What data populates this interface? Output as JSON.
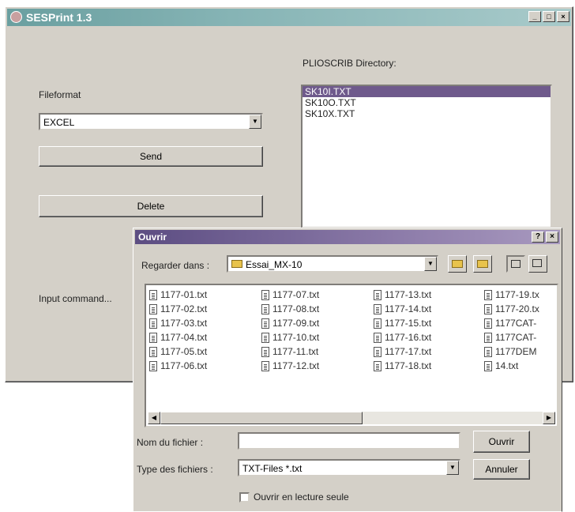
{
  "main_window": {
    "title": "SESPrint 1.3",
    "fileformat_label": "Fileformat",
    "fileformat_value": "EXCEL",
    "send_label": "Send",
    "delete_label": "Delete",
    "input_command_label": "Input command...",
    "directory_label": "PLIOSCRIB Directory:",
    "directory_files": [
      "SK10I.TXT",
      "SK10O.TXT",
      "SK10X.TXT"
    ],
    "selected_file": "SK10I.TXT"
  },
  "open_dialog": {
    "title": "Ouvrir",
    "look_in_label": "Regarder dans :",
    "look_in_value": "Essai_MX-10",
    "files_col1": [
      "1177-01.txt",
      "1177-02.txt",
      "1177-03.txt",
      "1177-04.txt",
      "1177-05.txt",
      "1177-06.txt"
    ],
    "files_col2": [
      "1177-07.txt",
      "1177-08.txt",
      "1177-09.txt",
      "1177-10.txt",
      "1177-11.txt",
      "1177-12.txt"
    ],
    "files_col3": [
      "1177-13.txt",
      "1177-14.txt",
      "1177-15.txt",
      "1177-16.txt",
      "1177-17.txt",
      "1177-18.txt"
    ],
    "files_col4": [
      "1177-19.tx",
      "1177-20.tx",
      "1177CAT-",
      "1177CAT-",
      "1177DEM",
      "14.txt"
    ],
    "filename_label": "Nom du fichier :",
    "filename_value": "",
    "filetype_label": "Type des fichiers :",
    "filetype_value": "TXT-Files *.txt",
    "open_button": "Ouvrir",
    "cancel_button": "Annuler",
    "readonly_label": "Ouvrir en lecture seule"
  },
  "icons": {
    "app": "app-icon",
    "help": "help-icon",
    "close": "close-icon",
    "folder": "folder-icon",
    "up_folder": "up-folder-icon",
    "new_folder": "new-folder-icon",
    "list_view": "list-view-icon",
    "details_view": "details-view-icon"
  }
}
